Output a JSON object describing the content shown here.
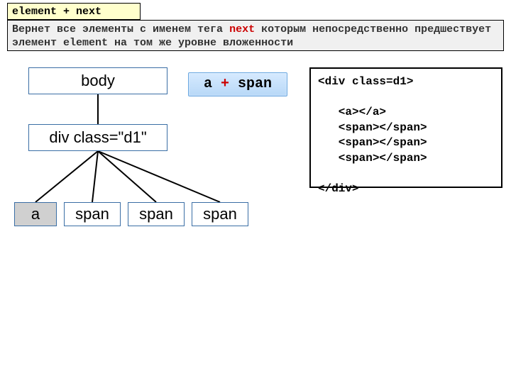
{
  "title": "element + next",
  "explanation": {
    "pre": "Вернет все  элементы с именем тега ",
    "next": "next",
    "mid": " которым  непосредственно предшествует  элемент ",
    "elem": "element",
    "post": " на том же уровне вложенности"
  },
  "selector": {
    "a": "a",
    "plus": "+",
    "span": "span"
  },
  "tree": {
    "body": "body",
    "div": "div class=\"d1\"",
    "a": "a",
    "span1": "span",
    "span2": "span",
    "span3": "span"
  },
  "code": "<div class=d1>\n\n   <a></a>\n   <span></span>\n   <span></span>\n   <span></span>\n\n</div>"
}
